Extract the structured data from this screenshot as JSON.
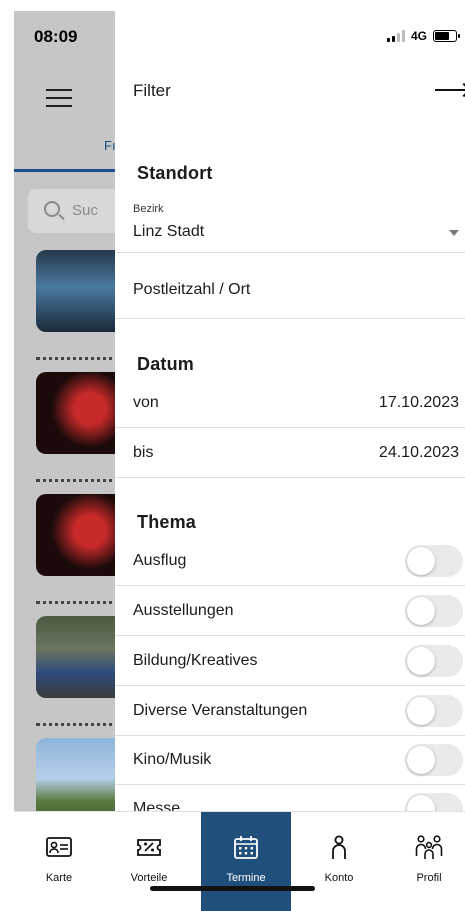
{
  "status": {
    "time": "08:09",
    "network": "4G"
  },
  "background": {
    "tab_partial": "Fı",
    "search_placeholder": "Suc"
  },
  "drawer": {
    "title": "Filter",
    "standort": {
      "heading": "Standort",
      "bezirk_label": "Bezirk",
      "bezirk_value": "Linz Stadt",
      "plz_placeholder": "Postleitzahl / Ort"
    },
    "datum": {
      "heading": "Datum",
      "von_label": "von",
      "von_value": "17.10.2023",
      "bis_label": "bis",
      "bis_value": "24.10.2023"
    },
    "thema": {
      "heading": "Thema",
      "items": [
        {
          "label": "Ausflug",
          "enabled": false
        },
        {
          "label": "Ausstellungen",
          "enabled": false
        },
        {
          "label": "Bildung/Kreatives",
          "enabled": false
        },
        {
          "label": "Diverse Veranstaltungen",
          "enabled": false
        },
        {
          "label": "Kino/Musik",
          "enabled": false
        },
        {
          "label": "Messe",
          "enabled": false
        }
      ]
    }
  },
  "bottom_nav": {
    "active": "Termine",
    "active_color": "#1f4f7a",
    "items": [
      {
        "label": "Karte",
        "icon": "id-card-icon"
      },
      {
        "label": "Vorteile",
        "icon": "ticket-percent-icon"
      },
      {
        "label": "Termine",
        "icon": "calendar-icon"
      },
      {
        "label": "Konto",
        "icon": "person-icon"
      },
      {
        "label": "Profil",
        "icon": "family-icon"
      }
    ]
  }
}
